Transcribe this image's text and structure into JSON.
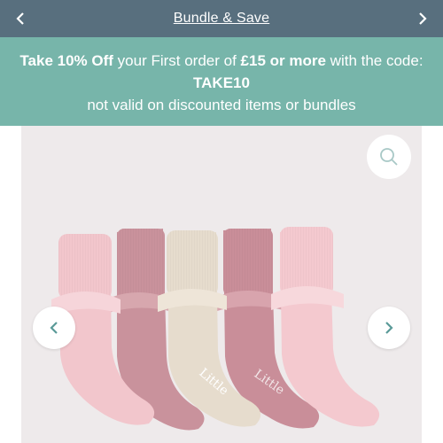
{
  "announcement_bar": {
    "title": "Bundle & Save",
    "prev_icon": "chevron-left-icon",
    "next_icon": "chevron-right-icon",
    "background": "#586f7e"
  },
  "promo": {
    "bold_1": "Take 10% Off",
    "text_1": " your First order of ",
    "bold_2": "£15 or more",
    "text_2": " with the code: ",
    "code": "TAKE10",
    "subtext": "not valid on discounted items or bundles",
    "background": "#77b5aa"
  },
  "gallery": {
    "zoom_icon": "search-icon",
    "prev_icon": "chevron-left-icon",
    "next_icon": "chevron-right-icon",
    "product_image": "five pairs of frilly lace-trim baby socks in pink, mauve and oatmeal",
    "sock_print": "Little",
    "sock_colors": [
      "#f2c6cc",
      "#c9929c",
      "#e6dccd",
      "#c98e99",
      "#f4c9cf"
    ]
  }
}
